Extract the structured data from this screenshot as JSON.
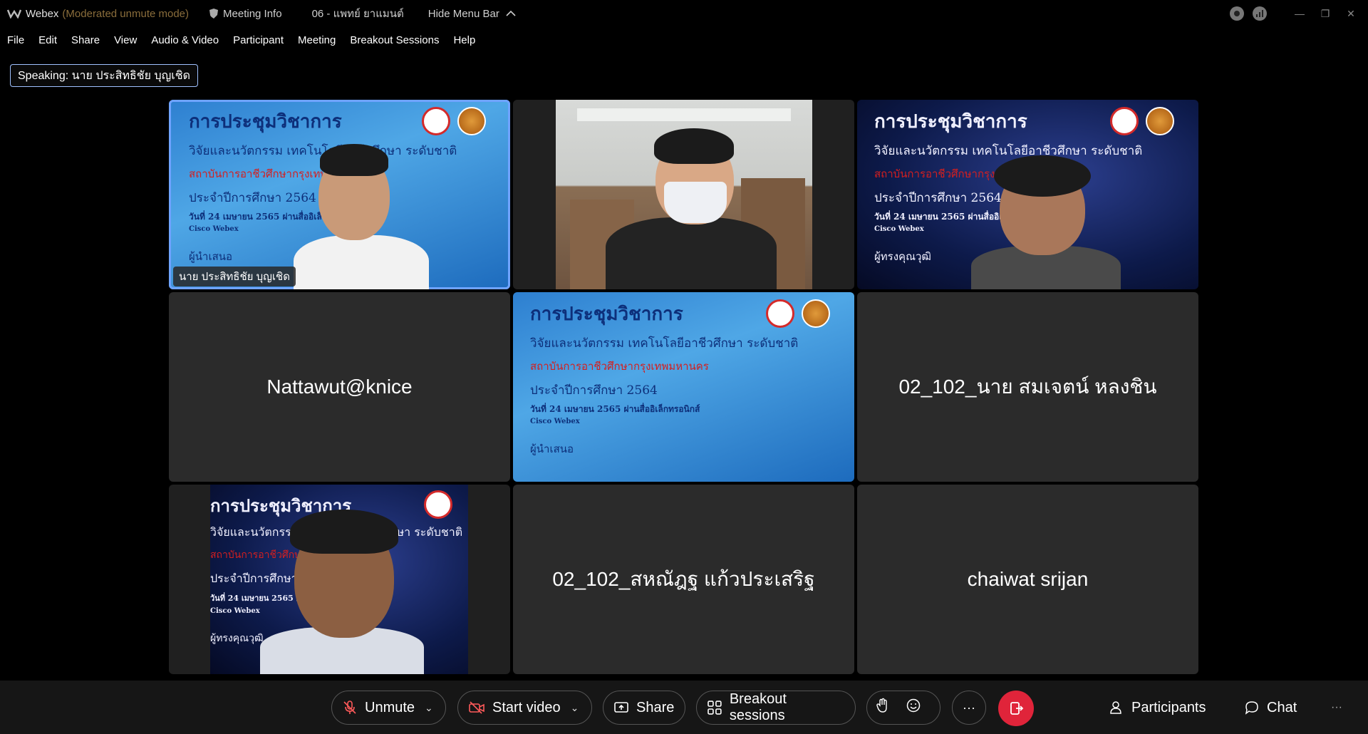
{
  "titlebar": {
    "app_name": "Webex",
    "mode": "(Moderated unmute mode)",
    "meeting_info": "Meeting Info",
    "meeting_number": "06 - แพทย์ ยาแมนต์",
    "hide_menu": "Hide Menu Bar"
  },
  "menu": [
    "File",
    "Edit",
    "Share",
    "View",
    "Audio & Video",
    "Participant",
    "Meeting",
    "Breakout Sessions",
    "Help"
  ],
  "speaking": "Speaking: นาย ประสิทธิชัย บุญเชิด",
  "tiles": {
    "t1_label": "นาย ประสิทธิชัย บุญเชิด",
    "t4_name": "Nattawut@knice",
    "t6_name": "02_102_นาย สมเจตน์ หลงชิน",
    "t8_name": "02_102_สหณัฎฐ แก้วประเสริฐ",
    "t9_name": "chaiwat srijan",
    "slide_title": "การประชุมวิชาการ",
    "slide_line1": "วิจัยและนวัตกรรม เทคโนโลยีอาชีวศึกษา ระดับชาติ",
    "slide_line2": "สถาบันการอาชีวศึกษากรุงเทพมหานคร",
    "slide_line3": "ประจำปีการศึกษา 2564",
    "slide_line4": "วันที่ 24 เมษายน 2565 ผ่านสื่ออิเล็กทรอนิกส์",
    "slide_line5": "Cisco Webex",
    "slide_line6": "ผู้นำเสนอ",
    "slide_line6b": "ผู้ทรงคุณวุฒิ"
  },
  "toolbar": {
    "unmute": "Unmute",
    "start_video": "Start video",
    "share": "Share",
    "breakout": "Breakout sessions",
    "more": "···",
    "participants": "Participants",
    "chat": "Chat",
    "overflow": "···"
  }
}
